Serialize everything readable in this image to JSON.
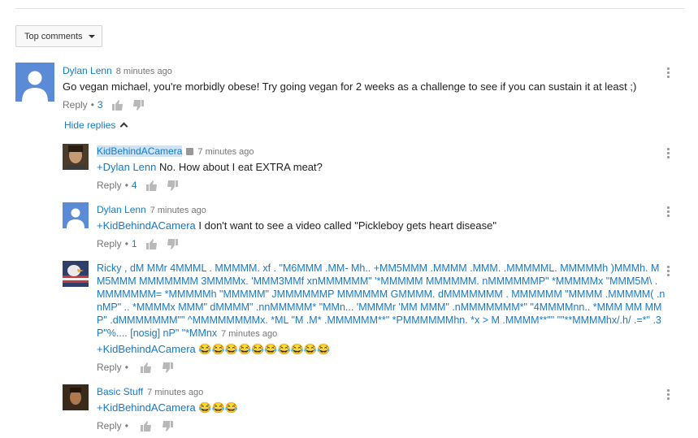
{
  "sort": {
    "label": "Top comments"
  },
  "threads": [
    {
      "author": "Dylan Lenn",
      "time": "8 minutes ago",
      "text": "Go vegan michael, you're morbidly obese! Try going vegan for 2 weeks as a challenge to see if you can sustain it at least ;)",
      "reply_label": "Reply",
      "likes": "3",
      "hide_replies_label": "Hide replies",
      "replies": [
        {
          "author": "KidBehindACamera",
          "time": "7 minutes ago",
          "mention": "+Dylan Lenn",
          "text": " No. How about I eat EXTRA meat?",
          "reply_label": "Reply",
          "likes": "4"
        },
        {
          "author": "Dylan Lenn",
          "time": "7 minutes ago",
          "mention": "+KidBehindACamera",
          "text": " I don't want to see a video called \"Pickleboy gets heart disease\"",
          "reply_label": "Reply",
          "likes": "1"
        },
        {
          "author_and_text": "Ricky , dM MMr 4MMML . MMMMM. xf . \"M6MMM .MM- Mh.. +MM5MMM .MMMM .MMM. .MMMMML. MMMMMh )MMMh. MM5MMM MMMMMMM 3MMMMx. 'MMM3MMf xnMMMMMM\" '*MMMMM MMMMMM. nMMMMMMP\" *MMMMMx \"MMM5M\\ .MMMMMMM= *MMMMMh \"MMMMM\" JMMMMMMP MMMMMM GMMMM. dMMMMMMM . MMMMMM \"MMMM .MMMMM( .nnMP\" .. *MMMMx MMM\" dMMMM\" .nnMMMMM* \"MMn... 'MMMMr 'MM MMM\" .nMMMMMMM*\" \"4MMMMnn.. *MMM MM MMP\" .dMMMMMMM\"\" ^MMMMMMMMx. *ML \"M .M* .MMMMMM**\" *PMMMMMMhn. *x > M .MMMM**\"\" \"\"**MMMMhx/.h/ .=*\" .3P\"%.... [nosig] nP\" \"*MMnx",
          "time": "7 minutes ago",
          "mention": "+KidBehindACamera",
          "text": " 😂😂😂😂😂😂😂😂😂😂",
          "reply_label": "Reply"
        },
        {
          "author": "Basic Stuff",
          "time": "7 minutes ago",
          "mention": "+KidBehindACamera",
          "text": " 😂😂😂",
          "reply_label": "Reply"
        }
      ]
    }
  ],
  "colors": {
    "link": "#167ac6",
    "avatar_default": "#5b8bd6",
    "meta": "#767676"
  },
  "icons": {
    "like": "thumbs-up-icon",
    "dislike": "thumbs-down-icon",
    "menu": "more-vert-icon"
  }
}
